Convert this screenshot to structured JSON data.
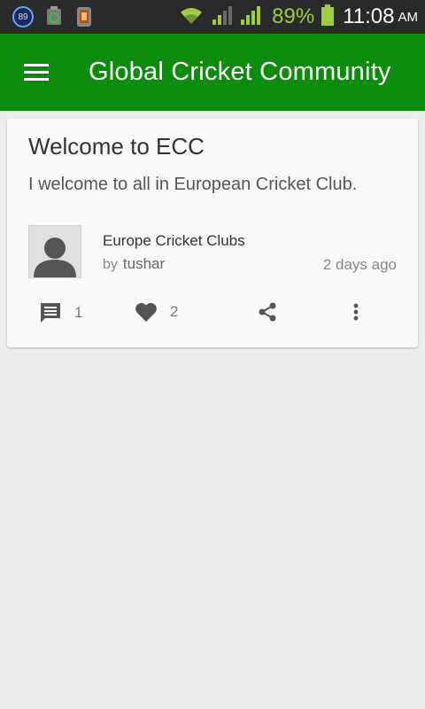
{
  "status_bar": {
    "notification_badge": "89",
    "battery_percent": "89%",
    "time": "11:08",
    "ampm": "AM",
    "icons": [
      "notification-badge-icon",
      "android-app-icon",
      "phone-app-icon",
      "wifi-icon",
      "signal-icon",
      "signal-icon",
      "battery-icon"
    ]
  },
  "app_bar": {
    "title": "Global Cricket Community",
    "menu_icon": "hamburger-menu-icon",
    "color": "#0d8b0d"
  },
  "post": {
    "title": "Welcome to ECC",
    "body": "I welcome to all in European Cricket Club.",
    "group": "Europe Cricket Clubs",
    "by_label": "by",
    "author": "tushar",
    "time_ago": "2 days ago",
    "avatar_icon": "person-avatar-icon",
    "actions": {
      "comments_count": "1",
      "likes_count": "2",
      "comment_icon": "comment-icon",
      "like_icon": "heart-icon",
      "share_icon": "share-icon",
      "more_icon": "more-vertical-icon"
    }
  }
}
